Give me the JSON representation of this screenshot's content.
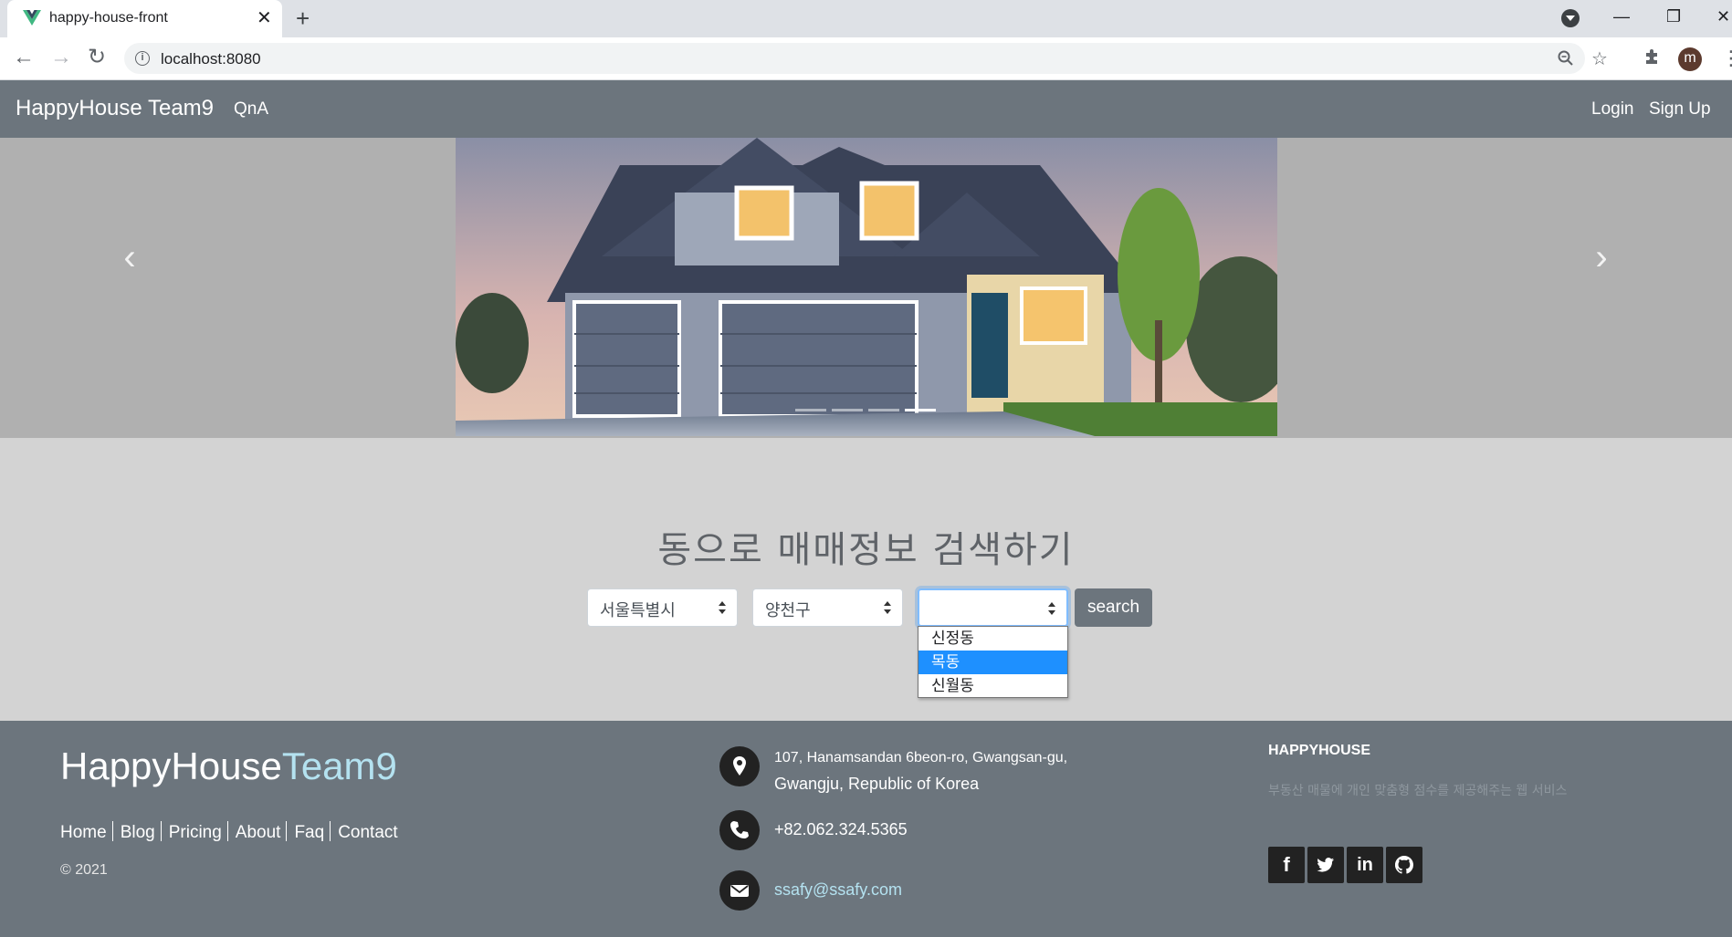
{
  "browser": {
    "tab_title": "happy-house-front",
    "tab_close": "✕",
    "new_tab": "+",
    "url": "localhost:8080",
    "avatar_letter": "m"
  },
  "navbar": {
    "brand": "HappyHouse Team9",
    "links": [
      "QnA"
    ],
    "right_links": [
      "Login",
      "Sign Up"
    ]
  },
  "carousel": {
    "slide_count": 4,
    "active_index": 3,
    "prev_icon": "chevron-left-icon",
    "next_icon": "chevron-right-icon"
  },
  "search": {
    "title": "동으로 매매정보 검색하기",
    "city_selected": "서울특별시",
    "district_selected": "양천구",
    "dong_selected": "",
    "button_label": "search",
    "dong_options": [
      "신정동",
      "목동",
      "신월동"
    ],
    "highlighted_option": "목동"
  },
  "footer": {
    "logo_main": "HappyHouse",
    "logo_accent": "Team9",
    "links": [
      "Home",
      "Blog",
      "Pricing",
      "About",
      "Faq",
      "Contact"
    ],
    "copyright": "© 2021",
    "address_line1": "107, Hanamsandan 6beon-ro, Gwangsan-gu,",
    "address_line2": "Gwangju, Republic of Korea",
    "phone": "+82.062.324.5365",
    "email": "ssafy@ssafy.com",
    "about_title": "HAPPYHOUSE",
    "about_text": "부동산 매물에 개인 맞춤형 점수를 제공해주는 웹 서비스",
    "social": [
      "facebook-icon",
      "twitter-icon",
      "linkedin-icon",
      "github-icon"
    ]
  },
  "colors": {
    "navbar_bg": "#6c757d",
    "page_bg": "#d3d3d3",
    "accent": "#b4e2f0",
    "option_highlight": "#1e90ff"
  }
}
